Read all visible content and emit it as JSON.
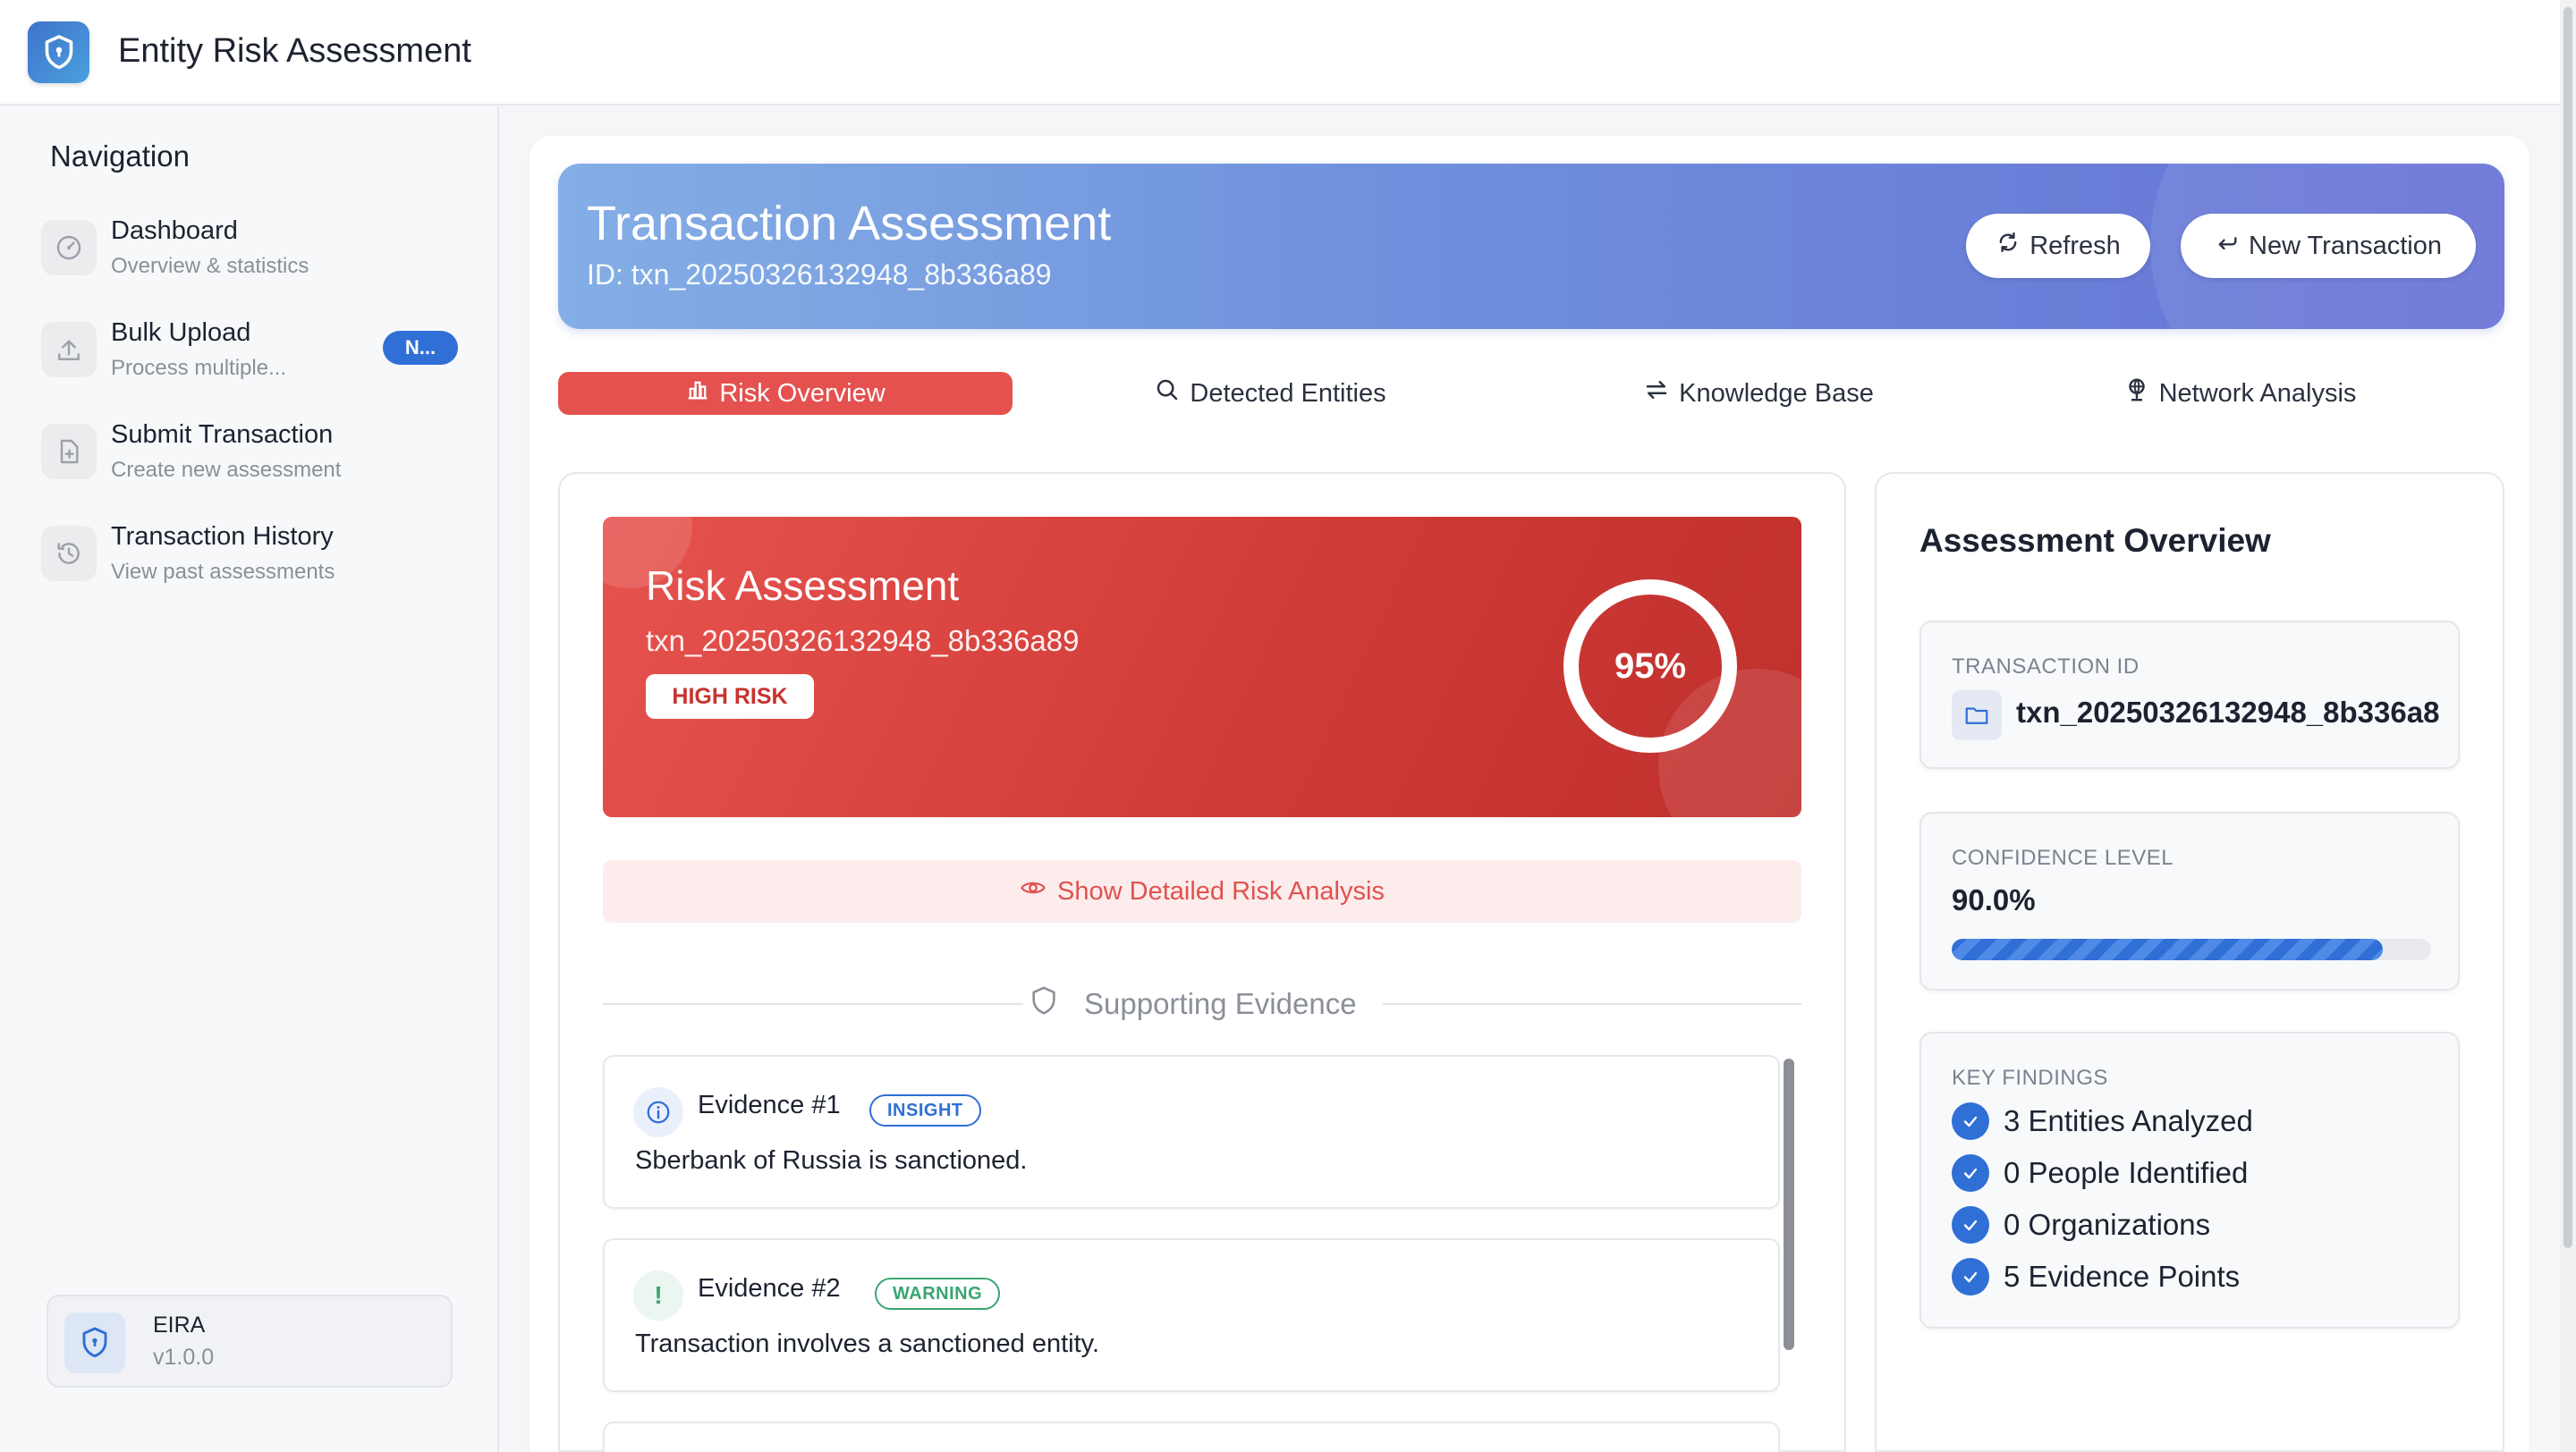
{
  "app": {
    "title": "Entity Risk Assessment"
  },
  "sidebar": {
    "heading": "Navigation",
    "items": [
      {
        "title": "Dashboard",
        "subtitle": "Overview & statistics",
        "icon": "gauge-icon"
      },
      {
        "title": "Bulk Upload",
        "subtitle": "Process multiple...",
        "icon": "upload-icon",
        "badge": "N..."
      },
      {
        "title": "Submit Transaction",
        "subtitle": "Create new assessment",
        "icon": "file-plus-icon"
      },
      {
        "title": "Transaction History",
        "subtitle": "View past assessments",
        "icon": "history-icon"
      }
    ],
    "version": {
      "name": "EIRA",
      "number": "v1.0.0"
    }
  },
  "header": {
    "title": "Transaction Assessment",
    "id_text": "ID: txn_20250326132948_8b336a89",
    "refresh_label": "Refresh",
    "new_transaction_label": "New Transaction"
  },
  "tabs": [
    {
      "label": "Risk Overview",
      "icon": "bar-chart-icon",
      "active": true
    },
    {
      "label": "Detected Entities",
      "icon": "search-icon",
      "active": false
    },
    {
      "label": "Knowledge Base",
      "icon": "swap-icon",
      "active": false
    },
    {
      "label": "Network Analysis",
      "icon": "globe-icon",
      "active": false
    }
  ],
  "risk": {
    "title": "Risk Assessment",
    "transaction_id": "txn_20250326132948_8b336a89",
    "level": "HIGH RISK",
    "score": "95%",
    "score_value": 95
  },
  "detail_button": "Show Detailed Risk Analysis",
  "evidence": {
    "heading": "Supporting Evidence",
    "items": [
      {
        "title": "Evidence #1",
        "tag": "INSIGHT",
        "text": "Sberbank of Russia is sanctioned."
      },
      {
        "title": "Evidence #2",
        "tag": "WARNING",
        "text": "Transaction involves a sanctioned entity."
      }
    ]
  },
  "overview": {
    "title": "Assessment Overview",
    "transaction_id_label": "TRANSACTION ID",
    "transaction_id_value": "txn_20250326132948_8b336a8",
    "confidence_label": "CONFIDENCE LEVEL",
    "confidence_value": "90.0%",
    "confidence_fraction": 0.9,
    "findings_label": "KEY FINDINGS",
    "findings": [
      "3 Entities Analyzed",
      "0 People Identified",
      "0 Organizations",
      "5 Evidence Points"
    ]
  },
  "colors": {
    "accent_blue": "#2f6fd6",
    "risk_red": "#d13b37",
    "insight_blue": "#2f6fd6",
    "warning_green": "#3aa572"
  }
}
